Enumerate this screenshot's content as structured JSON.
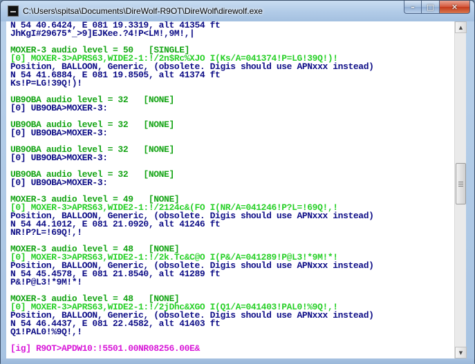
{
  "window": {
    "title": "C:\\Users\\spitsa\\Documents\\DireWolf-R9OT\\DireWolf\\direwolf.exe",
    "controls": {
      "minimize": "–",
      "maximize": "□",
      "close": "✕"
    }
  },
  "colors": {
    "blue": "#0d0d86",
    "green": "#14a414",
    "bright_green": "#28d028",
    "magenta": "#d818d8"
  },
  "console": {
    "lines": [
      {
        "text": "N 54 40.6424, E 081 19.3319, alt 41354 ft",
        "color": "blue"
      },
      {
        "text": "JhKgI#29675*_>9]EJKee.?4!P<LM!,9M!,|",
        "color": "blue"
      },
      {
        "text": "",
        "color": "blue"
      },
      {
        "text": "MOXER-3 audio level = 50   [SINGLE]",
        "color": "green"
      },
      {
        "text": "[0] MOXER-3>APRS63,WIDE2-1:!/2n$Rc%XJO I(Ks/A=041374!P=LG!39Q!)!",
        "color": "bright"
      },
      {
        "text": "Position, BALLOON, Generic, (obsolete. Digis should use APNxxx instead)",
        "color": "blue"
      },
      {
        "text": "N 54 41.6884, E 081 19.8505, alt 41374 ft",
        "color": "blue"
      },
      {
        "text": "Ks!P=LG!39Q!)!",
        "color": "blue"
      },
      {
        "text": "",
        "color": "blue"
      },
      {
        "text": "UB9OBA audio level = 32   [NONE]",
        "color": "green"
      },
      {
        "text": "[0] UB9OBA>MOXER-3:",
        "color": "blue"
      },
      {
        "text": "",
        "color": "blue"
      },
      {
        "text": "UB9OBA audio level = 32   [NONE]",
        "color": "green"
      },
      {
        "text": "[0] UB9OBA>MOXER-3:",
        "color": "blue"
      },
      {
        "text": "",
        "color": "blue"
      },
      {
        "text": "UB9OBA audio level = 32   [NONE]",
        "color": "green"
      },
      {
        "text": "[0] UB9OBA>MOXER-3:",
        "color": "blue"
      },
      {
        "text": "",
        "color": "blue"
      },
      {
        "text": "UB9OBA audio level = 32   [NONE]",
        "color": "green"
      },
      {
        "text": "[0] UB9OBA>MOXER-3:",
        "color": "blue"
      },
      {
        "text": "",
        "color": "blue"
      },
      {
        "text": "MOXER-3 audio level = 49   [NONE]",
        "color": "green"
      },
      {
        "text": "[0] MOXER-3>APRS63,WIDE2-1:!/2124c&(FO I(NR/A=041246!P?L=!69Q!,!",
        "color": "bright"
      },
      {
        "text": "Position, BALLOON, Generic, (obsolete. Digis should use APNxxx instead)",
        "color": "blue"
      },
      {
        "text": "N 54 44.1012, E 081 21.0920, alt 41246 ft",
        "color": "blue"
      },
      {
        "text": "NR!P?L=!69Q!,!",
        "color": "blue"
      },
      {
        "text": "",
        "color": "blue"
      },
      {
        "text": "MOXER-3 audio level = 48   [NONE]",
        "color": "green"
      },
      {
        "text": "[0] MOXER-3>APRS63,WIDE2-1:!/2k.Tc&C@O I(P&/A=041289!P@L3!*9M!*!",
        "color": "bright"
      },
      {
        "text": "Position, BALLOON, Generic, (obsolete. Digis should use APNxxx instead)",
        "color": "blue"
      },
      {
        "text": "N 54 45.4578, E 081 21.8540, alt 41289 ft",
        "color": "blue"
      },
      {
        "text": "P&!P@L3!*9M!*!",
        "color": "blue"
      },
      {
        "text": "",
        "color": "blue"
      },
      {
        "text": "MOXER-3 audio level = 48   [NONE]",
        "color": "green"
      },
      {
        "text": "[0] MOXER-3>APRS63,WIDE2-1:!/2jDhc&XGO I(Q1/A=041403!PAL0!%9Q!,!",
        "color": "bright"
      },
      {
        "text": "Position, BALLOON, Generic, (obsolete. Digis should use APNxxx instead)",
        "color": "blue"
      },
      {
        "text": "N 54 46.4437, E 081 22.4582, alt 41403 ft",
        "color": "blue"
      },
      {
        "text": "Q1!PAL0!%9Q!,!",
        "color": "blue"
      },
      {
        "text": "",
        "color": "blue"
      },
      {
        "text": "[ig] R9OT>APDW10:!5501.00NR08256.00E&",
        "color": "magenta"
      }
    ]
  },
  "scrollbar": {
    "up_arrow": "▲",
    "down_arrow": "▼"
  }
}
